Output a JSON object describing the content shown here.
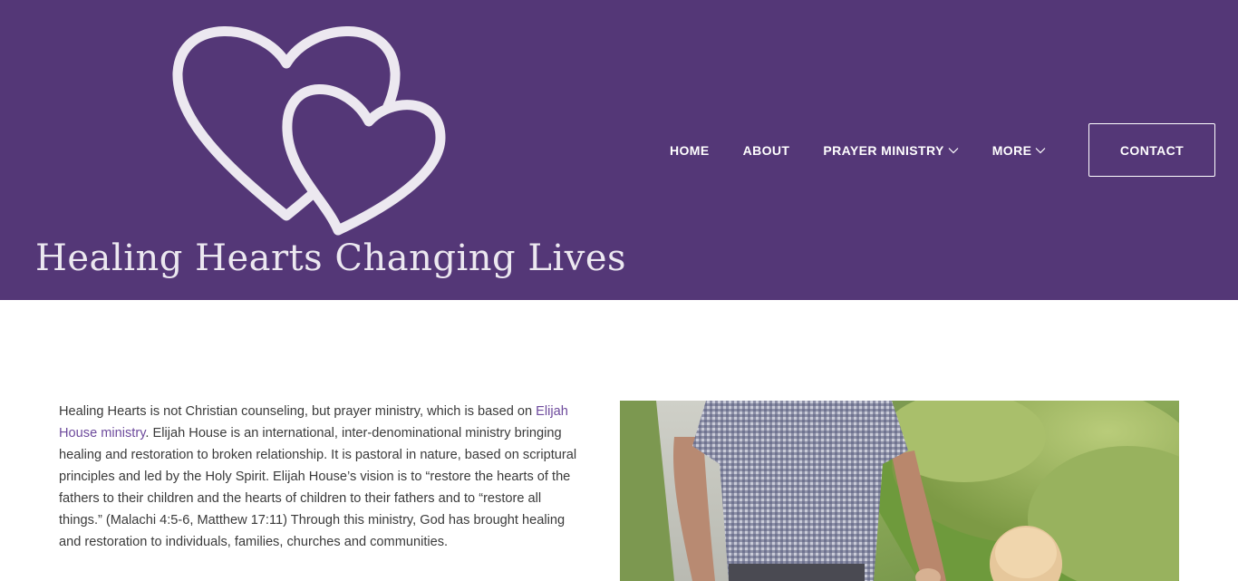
{
  "site": {
    "title": "Healing Hearts Changing Lives",
    "logo_icon": "double-heart-outline-icon"
  },
  "nav": {
    "items": [
      {
        "label": "HOME",
        "has_dropdown": false
      },
      {
        "label": "ABOUT",
        "has_dropdown": false
      },
      {
        "label": "PRAYER MINISTRY",
        "has_dropdown": true
      },
      {
        "label": "MORE",
        "has_dropdown": true
      }
    ],
    "contact_label": "CONTACT"
  },
  "intro": {
    "text_before_link": "Healing Hearts is not Christian counseling, but prayer ministry, which is based on ",
    "link_text": "Elijah House ministry",
    "text_after_link": ". Elijah House is an international, inter-denominational ministry bringing healing and restoration to broken relationship. It is pastoral in nature, based on scriptural principles and led by the Holy Spirit. Elijah House’s vision is to “restore the hearts of the fathers to their children and the hearts of children to their fathers and to “restore all things.” (Malachi 4:5-6, Matthew 17:11) Through this ministry, God has brought healing and restoration to individuals, families, churches and communities."
  },
  "colors": {
    "header_bg": "#543777",
    "logo_stroke": "#ece8f0",
    "link": "#6d4a9c",
    "body_text": "#3a3a3a"
  },
  "photo": {
    "subject": "grandfather-and-child-walking-photo"
  }
}
